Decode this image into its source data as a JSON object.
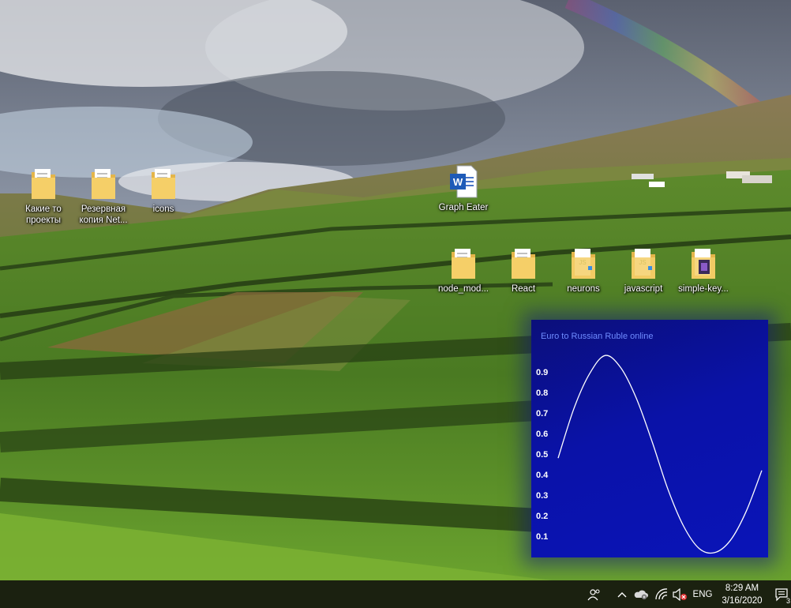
{
  "desktop": {
    "icons": [
      {
        "label": "Какие то проекты",
        "type": "folder"
      },
      {
        "label": "Резервная копия Net...",
        "type": "folder"
      },
      {
        "label": "icons",
        "type": "folder"
      },
      {
        "label": "Graph Eater",
        "type": "word-document"
      },
      {
        "label": "node_mod...",
        "type": "folder"
      },
      {
        "label": "React",
        "type": "folder"
      },
      {
        "label": "neurons",
        "type": "folder-js"
      },
      {
        "label": "javascript",
        "type": "folder-js"
      },
      {
        "label": "simple-key...",
        "type": "folder-app"
      }
    ]
  },
  "widget": {
    "title": "Euro to Russian Ruble online",
    "colors": {
      "background": "#0a12a8",
      "title": "#6f8cff",
      "line": "#ffffff"
    }
  },
  "chart_data": {
    "type": "line",
    "title": "Euro to Russian Ruble online",
    "y_ticks": [
      "0.9",
      "0.8",
      "0.7",
      "0.6",
      "0.5",
      "0.4",
      "0.3",
      "0.2",
      "0.1"
    ],
    "ylim": [
      0,
      1
    ],
    "x": [
      0,
      0.5,
      1,
      1.5,
      2,
      2.5,
      3,
      3.5,
      4,
      4.5,
      5,
      5.5,
      6,
      6.5
    ],
    "values": [
      0.48,
      0.72,
      0.89,
      0.98,
      0.92,
      0.77,
      0.56,
      0.33,
      0.15,
      0.04,
      0.02,
      0.08,
      0.22,
      0.42
    ],
    "grid": false,
    "legend": "none"
  },
  "taskbar": {
    "tray": [
      {
        "icon": "people-icon"
      },
      {
        "icon": "chevron-up-icon"
      },
      {
        "icon": "onedrive-icon"
      },
      {
        "icon": "wifi-icon"
      },
      {
        "icon": "volume-muted-icon"
      }
    ],
    "language": "ENG",
    "time": "8:29 AM",
    "date": "3/16/2020",
    "notification_count": "3"
  }
}
